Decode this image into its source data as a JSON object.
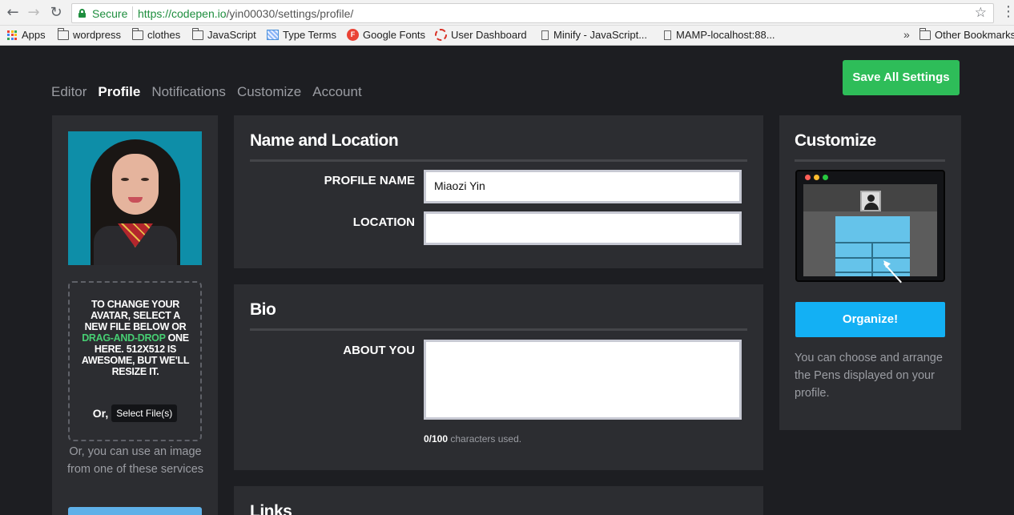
{
  "browser": {
    "secure_label": "Secure",
    "url_host": "https://codepen.io",
    "url_path": "/yin00030/settings/profile/",
    "bookmarks": [
      {
        "label": "Apps",
        "icon": "apps-grid-icon"
      },
      {
        "label": "wordpress",
        "icon": "folder-icon"
      },
      {
        "label": "clothes",
        "icon": "folder-icon"
      },
      {
        "label": "JavaScript",
        "icon": "folder-icon"
      },
      {
        "label": "Type Terms",
        "icon": "striped-page-icon"
      },
      {
        "label": "Google Fonts",
        "icon": "google-fonts-icon"
      },
      {
        "label": "User Dashboard",
        "icon": "dashed-circle-icon"
      },
      {
        "label": "Minify - JavaScript...",
        "icon": "page-icon"
      },
      {
        "label": "MAMP-localhost:88...",
        "icon": "page-icon"
      }
    ],
    "overflow_chevrons": "»",
    "other_bookmarks": "Other Bookmarks"
  },
  "header": {
    "tabs": [
      {
        "label": "Editor",
        "active": false
      },
      {
        "label": "Profile",
        "active": true
      },
      {
        "label": "Notifications",
        "active": false
      },
      {
        "label": "Customize",
        "active": false
      },
      {
        "label": "Account",
        "active": false
      }
    ],
    "save_label": "Save All Settings"
  },
  "avatar_panel": {
    "drop_text_1": "TO CHANGE YOUR AVATAR, SELECT A NEW FILE BELOW OR ",
    "drop_text_highlight": "DRAG-AND-DROP",
    "drop_text_2": " ONE HERE. 512X512 IS AWESOME, BUT WE'LL RESIZE IT.",
    "or_label": "Or,",
    "select_files_label": "Select File(s)",
    "services_text": "Or, you can use an image from one of these services"
  },
  "name_location": {
    "title": "Name and Location",
    "profile_name_label": "PROFILE NAME",
    "profile_name_value": "Miaozi Yin",
    "location_label": "LOCATION",
    "location_value": ""
  },
  "bio": {
    "title": "Bio",
    "about_label": "ABOUT YOU",
    "about_value": "",
    "char_count": "0/100",
    "char_suffix": " characters used."
  },
  "links": {
    "title": "Links"
  },
  "customize": {
    "title": "Customize",
    "organize_label": "Organize!",
    "description": "You can choose and arrange the Pens displayed on your profile."
  },
  "colors": {
    "save_green": "#2ebd59",
    "organize_blue": "#13b0f4",
    "highlight_green": "#47cf73",
    "panel_bg": "#2c2d31",
    "page_bg": "#1d1e22"
  }
}
